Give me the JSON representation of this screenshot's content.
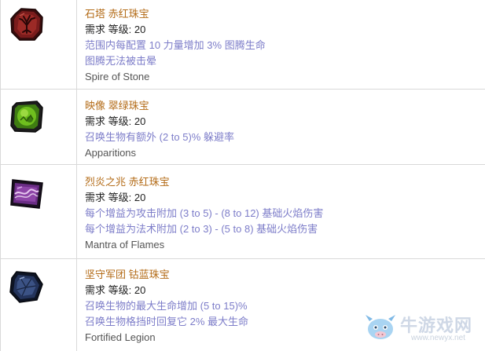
{
  "jewels": [
    {
      "title": "石塔 赤红珠宝",
      "requirement": "需求 等级: 20",
      "mods": [
        "范围内每配置 10 力量增加 3% 图腾生命",
        "图腾无法被击晕"
      ],
      "name": "Spire of Stone",
      "icon": "red-jewel-tree-icon"
    },
    {
      "title": "映像 翠绿珠宝",
      "requirement": "需求 等级: 20",
      "mods": [
        "召唤生物有额外 (2 to 5)% 躲避率"
      ],
      "name": "Apparitions",
      "icon": "green-jewel-icon"
    },
    {
      "title": "烈炎之兆 赤红珠宝",
      "requirement": "需求 等级: 20",
      "mods": [
        "每个增益为攻击附加 (3 to 5) - (8 to 12) 基础火焰伤害",
        "每个增益为法术附加 (2 to 3) - (5 to 8) 基础火焰伤害"
      ],
      "name": "Mantra of Flames",
      "icon": "purple-jewel-icon"
    },
    {
      "title": "坚守军团 钴蓝珠宝",
      "requirement": "需求 等级: 20",
      "mods": [
        "召唤生物的最大生命增加 (5 to 15)%",
        "召唤生物格挡时回复它 2% 最大生命"
      ],
      "name": "Fortified Legion",
      "icon": "blue-jewel-icon"
    }
  ],
  "watermark": {
    "text": "牛游戏网",
    "url": "www.newyx.net"
  },
  "colors": {
    "title": "#b36b17",
    "mod": "#7d7dc9",
    "border": "#d9d9d9"
  }
}
